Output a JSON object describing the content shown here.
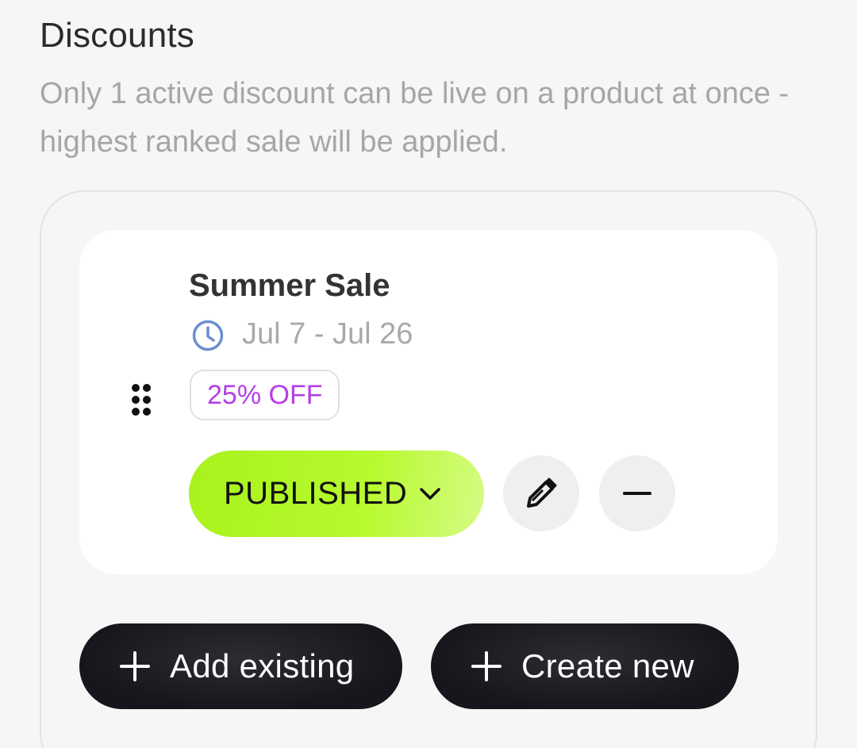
{
  "section": {
    "title": "Discounts",
    "description": "Only 1 active discount can be live on a product at once - highest ranked sale will be applied."
  },
  "discount": {
    "name": "Summer Sale",
    "date_range": "Jul 7 - Jul 26",
    "badge": "25% OFF",
    "status": "PUBLISHED"
  },
  "actions": {
    "add_existing": "Add existing",
    "create_new": "Create new"
  },
  "icons": {
    "drag": "drag-handle-icon",
    "clock": "clock-icon",
    "chevron": "chevron-down-icon",
    "edit": "pencil-icon",
    "remove": "minus-icon",
    "plus": "plus-icon"
  },
  "colors": {
    "status_green": "#b7fa2e",
    "badge_purple": "#b63ee6",
    "clock_blue": "#6b8fd1",
    "dark_button": "#15171c"
  }
}
